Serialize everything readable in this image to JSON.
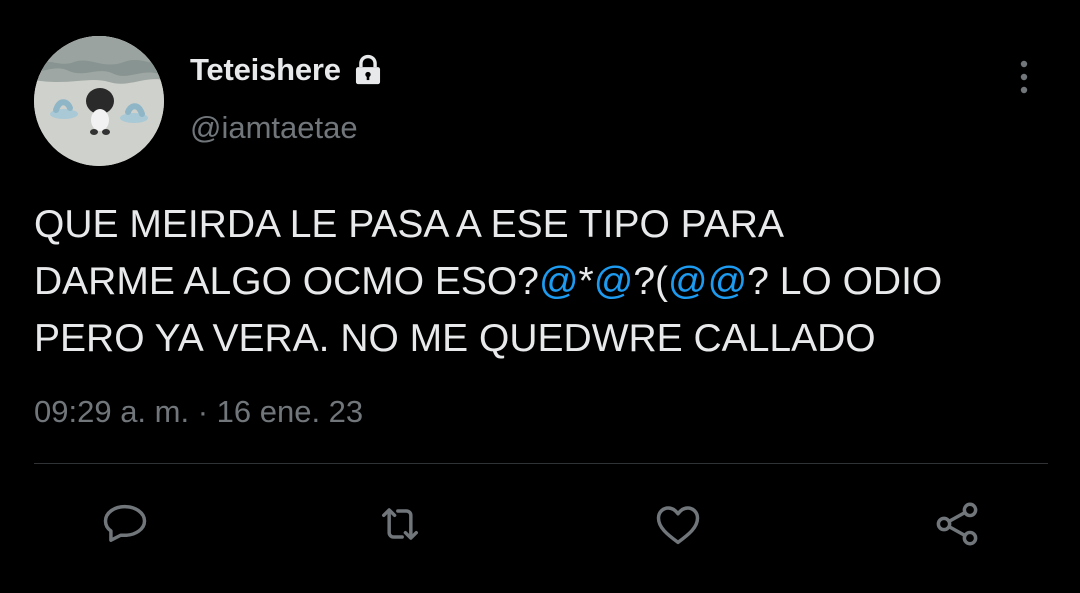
{
  "author": {
    "display_name": "Teteishere",
    "handle": "@iamtaetae",
    "protected_icon": "lock-icon"
  },
  "tweet": {
    "segments": [
      {
        "text": "QUE MEIRDA LE PASA A ESE TIPO PARA\nDARME ALGO OCMO ESO?",
        "type": "text"
      },
      {
        "text": "@",
        "type": "mention"
      },
      {
        "text": "*",
        "type": "text"
      },
      {
        "text": "@",
        "type": "mention"
      },
      {
        "text": "?(",
        "type": "text"
      },
      {
        "text": "@@",
        "type": "mention"
      },
      {
        "text": "? LO ODIO\nPERO YA VERA. NO ME QUEDWRE CALLADO",
        "type": "text"
      }
    ],
    "timestamp": "09:29 a. m. · 16 ene. 23"
  },
  "actions": {
    "reply_icon": "reply-icon",
    "retweet_icon": "retweet-icon",
    "like_icon": "heart-icon",
    "share_icon": "share-icon",
    "more_icon": "more-vertical-icon"
  },
  "colors": {
    "background": "#000000",
    "text": "#e7e9ea",
    "secondary": "#71767b",
    "mention": "#1d9bf0",
    "divider": "#2f3336"
  }
}
